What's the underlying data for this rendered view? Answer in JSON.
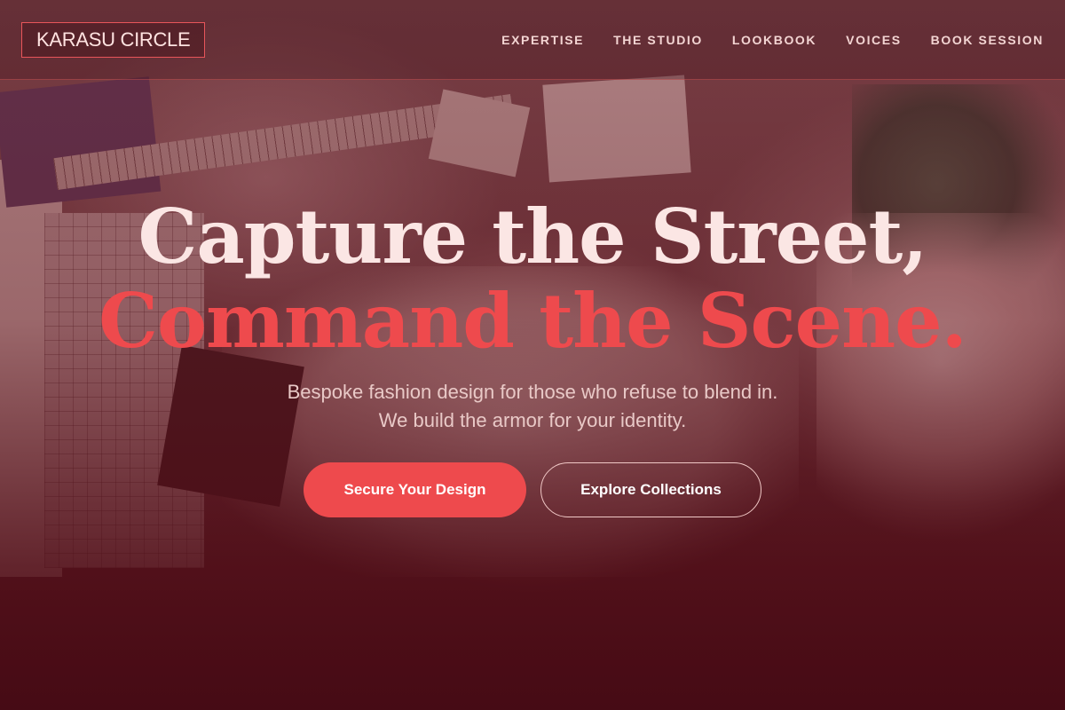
{
  "brand": {
    "name": "KARASU CIRCLE"
  },
  "nav": {
    "items": [
      {
        "label": "EXPERTISE"
      },
      {
        "label": "THE STUDIO"
      },
      {
        "label": "LOOKBOOK"
      },
      {
        "label": "VOICES"
      },
      {
        "label": "BOOK SESSION"
      }
    ]
  },
  "hero": {
    "headline_line1": "Capture the Street,",
    "headline_line2": "Command the Scene.",
    "subtitle_line1": "Bespoke fashion design for those who refuse to blend in.",
    "subtitle_line2": "We build the armor for your identity.",
    "primary_cta": "Secure Your Design",
    "secondary_cta": "Explore Collections"
  },
  "colors": {
    "accent": "#ee4a4d",
    "headline": "#fbe6e4",
    "background": "#3a1018"
  }
}
